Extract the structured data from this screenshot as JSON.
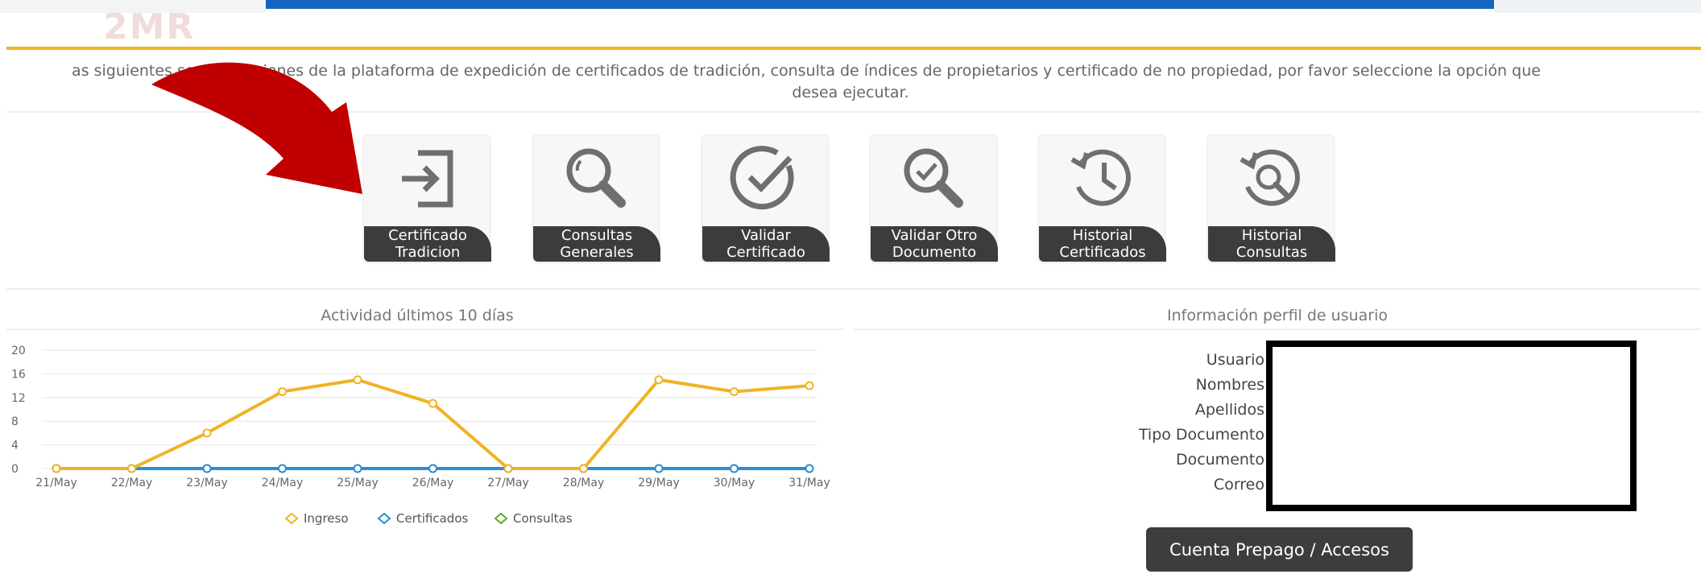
{
  "header": {
    "logo_fragment": "2MR"
  },
  "intro": {
    "line1": "as siguientes son las opciones de la plataforma de expedición de certificados de tradición, consulta de índices de propietarios y certificado de no propiedad, por favor seleccione la opción que",
    "line2": "desea ejecutar."
  },
  "tiles": [
    {
      "line1": "Certificado",
      "line2": "Tradicion",
      "icon": "sign-in-icon"
    },
    {
      "line1": "Consultas",
      "line2": "Generales",
      "icon": "search-icon"
    },
    {
      "line1": "Validar",
      "line2": "Certificado",
      "icon": "check-circle-icon"
    },
    {
      "line1": "Validar Otro",
      "line2": "Documento",
      "icon": "search-check-icon"
    },
    {
      "line1": "Historial",
      "line2": "Certificados",
      "icon": "history-clock-icon"
    },
    {
      "line1": "Historial",
      "line2": "Consultas",
      "icon": "history-search-icon"
    }
  ],
  "activity_panel": {
    "title": "Actividad últimos 10 días"
  },
  "profile_panel": {
    "title": "Información perfil de usuario",
    "labels": [
      "Usuario",
      "Nombres",
      "Apellidos",
      "Tipo Documento",
      "Documento",
      "Correo"
    ],
    "button_label": "Cuenta Prepago / Accesos"
  },
  "chart_data": {
    "type": "line",
    "categories": [
      "21/May",
      "22/May",
      "23/May",
      "24/May",
      "25/May",
      "26/May",
      "27/May",
      "28/May",
      "29/May",
      "30/May",
      "31/May"
    ],
    "ylim": [
      0,
      20
    ],
    "yticks": [
      0,
      4,
      8,
      12,
      16,
      20
    ],
    "grid": true,
    "legend_position": "bottom",
    "series": [
      {
        "name": "Ingreso",
        "color": "#f0b323",
        "values": [
          0,
          0,
          6,
          13,
          15,
          11,
          0,
          0,
          15,
          13,
          14
        ]
      },
      {
        "name": "Certificados",
        "color": "#2a8fd6",
        "values": [
          0,
          0,
          0,
          0,
          0,
          0,
          0,
          0,
          0,
          0,
          0
        ]
      },
      {
        "name": "Consultas",
        "color": "#5aac2e",
        "values": [
          0,
          0,
          0,
          0,
          0,
          0,
          0,
          0,
          0,
          0,
          0
        ]
      }
    ]
  },
  "annotation": {
    "arrow_color": "#c00000",
    "arrow_icon": "curved-arrow-icon"
  }
}
